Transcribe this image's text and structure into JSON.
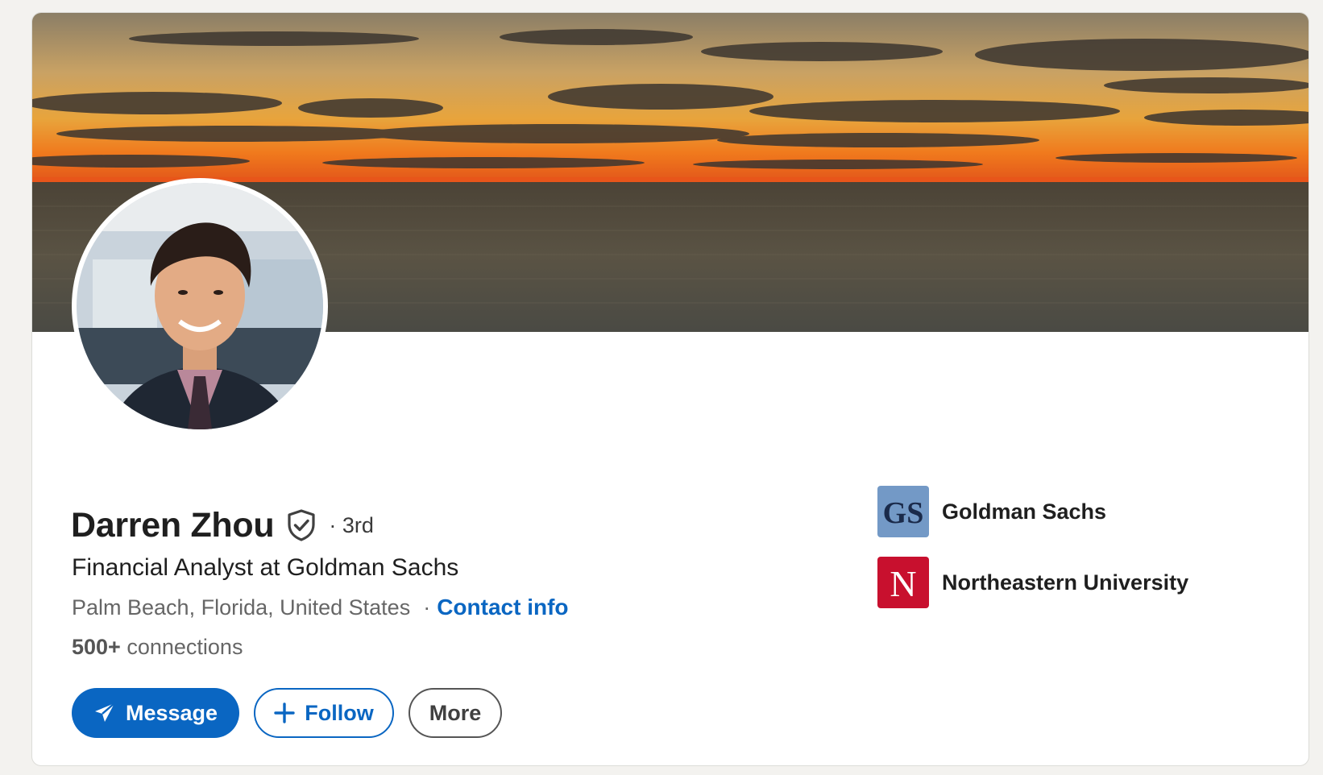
{
  "profile": {
    "name": "Darren Zhou",
    "degree": "· 3rd",
    "headline": "Financial Analyst at Goldman Sachs",
    "location": "Palm Beach, Florida, United States",
    "contact_label": "Contact info",
    "connections_count": "500+",
    "connections_label": "connections"
  },
  "actions": {
    "message_label": "Message",
    "follow_label": "Follow",
    "more_label": "More"
  },
  "orgs": [
    {
      "name": "Goldman Sachs",
      "logo_text": "GS",
      "logo_color": "#7399c6"
    },
    {
      "name": "Northeastern University",
      "logo_text": "N",
      "logo_color": "#c8102e"
    }
  ],
  "icons": {
    "verify": "shield-check-icon",
    "message": "paper-plane-icon",
    "follow": "plus-icon"
  },
  "colors": {
    "accent": "#0a66c2",
    "text_primary": "#1f1f1f",
    "text_secondary": "#666666"
  }
}
